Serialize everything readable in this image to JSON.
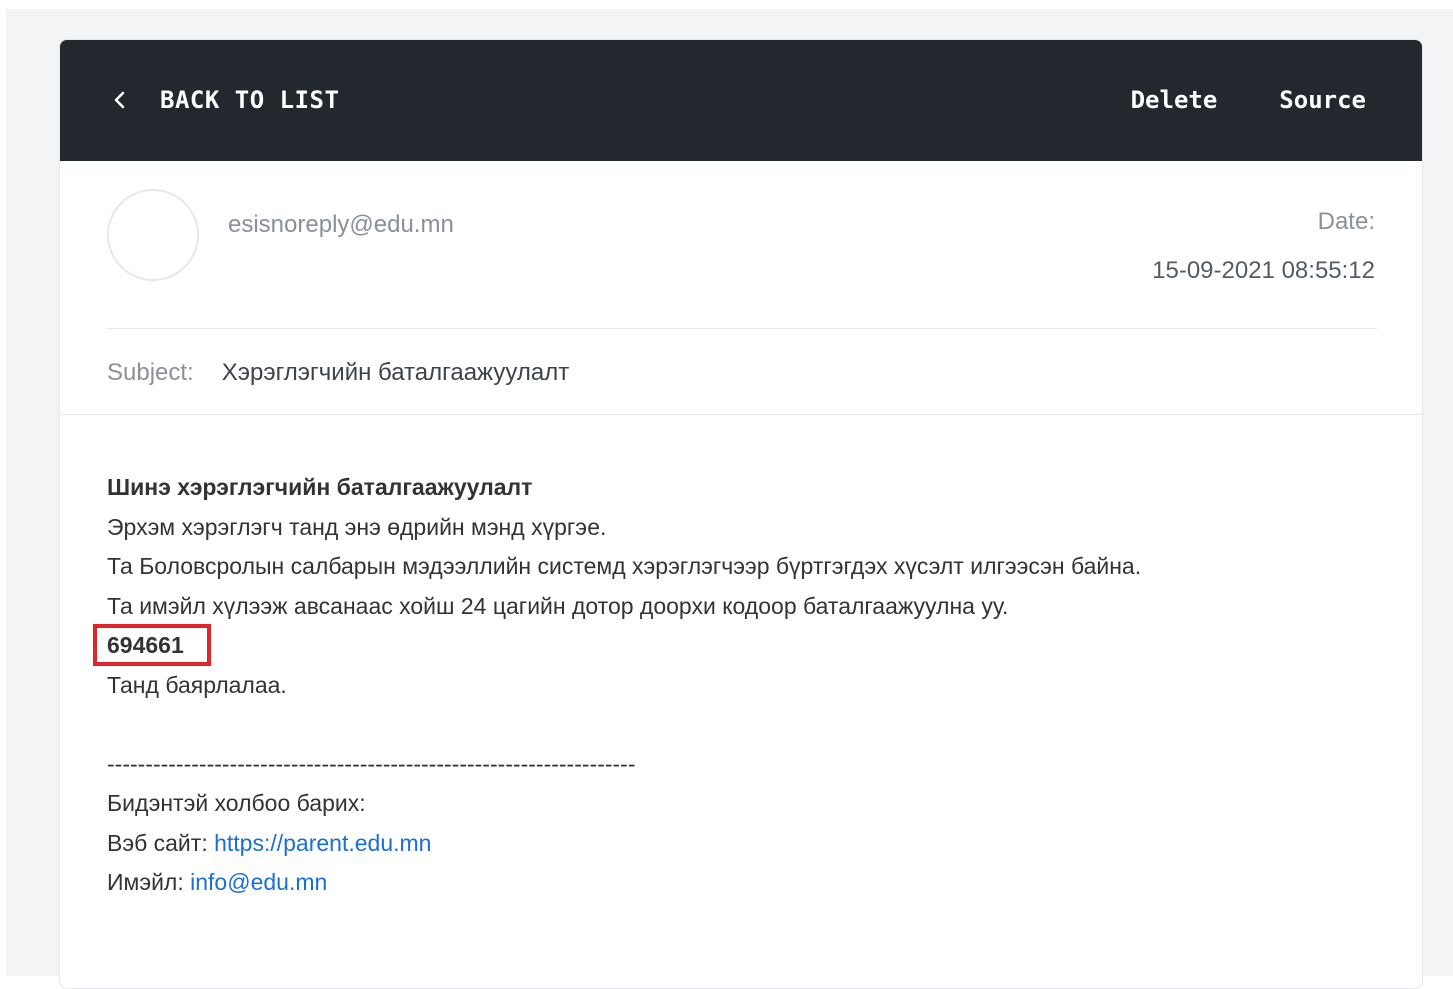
{
  "toolbar": {
    "back_label": "BACK TO LIST",
    "back_icon": "chevron-left-icon",
    "delete_label": "Delete",
    "source_label": "Source"
  },
  "header": {
    "sender": "esisnoreply@edu.mn",
    "date_label": "Date:",
    "date_value": "15-09-2021 08:55:12"
  },
  "subject": {
    "label": "Subject:",
    "text": "Хэрэглэгчийн баталгаажуулалт"
  },
  "message": {
    "heading": "Шинэ хэрэглэгчийн баталгаажуулалт",
    "greeting": "Эрхэм хэрэглэгч танд энэ өдрийн мэнд хүргэе.",
    "line1": "Та Боловсролын салбарын мэдээллийн системд хэрэглэгчээр бүртгэгдэх хүсэлт илгээсэн байна.",
    "line2": "Та имэйл хүлээж авсанаас хойш 24 цагийн дотор доорхи кодоор баталгаажуулна уу.",
    "code": "694661",
    "thanks": "Танд баярлалаа.",
    "divider": "---------------------------------------------------------------------",
    "contact_heading": "Бидэнтэй холбоо барих:",
    "website_label": "Вэб сайт:",
    "website_link": "https://parent.edu.mn",
    "email_label": "Имэйл:",
    "email_link": "info@edu.mn"
  },
  "colors": {
    "topbar_bg": "#23272e",
    "highlight": "#e0242c",
    "link": "#1a6fd1"
  }
}
